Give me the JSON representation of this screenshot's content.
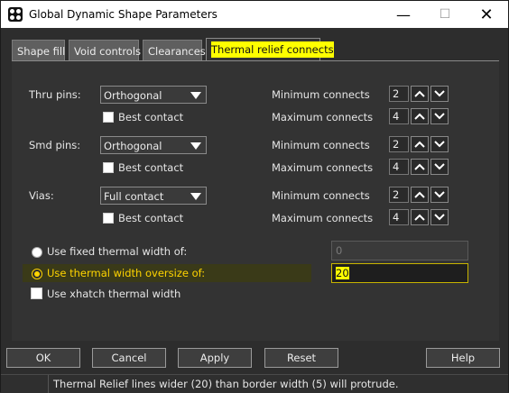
{
  "window": {
    "title": "Global Dynamic Shape Parameters"
  },
  "tabs": [
    {
      "label": "Shape fill"
    },
    {
      "label": "Void controls"
    },
    {
      "label": "Clearances"
    },
    {
      "label": "Thermal relief connects"
    }
  ],
  "rows": [
    {
      "label": "Thru pins:",
      "type": "Orthogonal",
      "best_contact": "Best contact",
      "min_label": "Minimum connects",
      "min_value": "2",
      "max_label": "Maximum connects",
      "max_value": "4"
    },
    {
      "label": "Smd pins:",
      "type": "Orthogonal",
      "best_contact": "Best contact",
      "min_label": "Minimum connects",
      "min_value": "2",
      "max_label": "Maximum connects",
      "max_value": "4"
    },
    {
      "label": "Vias:",
      "type": "Full contact",
      "best_contact": "Best contact",
      "min_label": "Minimum connects",
      "min_value": "2",
      "max_label": "Maximum connects",
      "max_value": "4"
    }
  ],
  "thermal_width": {
    "fixed_label": "Use fixed thermal width of:",
    "fixed_value": "0",
    "oversize_label": "Use thermal width oversize of:",
    "oversize_value": "20",
    "xhatch_label": "Use xhatch thermal width",
    "selected": "oversize"
  },
  "buttons": {
    "ok": "OK",
    "cancel": "Cancel",
    "apply": "Apply",
    "reset": "Reset",
    "help": "Help"
  },
  "status": "Thermal Relief lines wider (20) than border width (5) will protrude.",
  "colors": {
    "highlight": "#ffff00",
    "selection_border": "#ffd400"
  },
  "icons": {
    "minimize": "minimize-icon",
    "maximize": "maximize-icon",
    "close": "close-icon",
    "spin_up": "chevron-up-icon",
    "spin_down": "chevron-down-icon"
  }
}
